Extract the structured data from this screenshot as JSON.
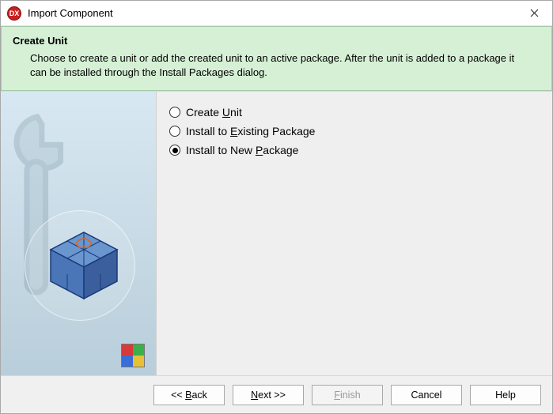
{
  "window": {
    "app_icon_text": "DX",
    "title": "Import Component"
  },
  "header": {
    "title": "Create Unit",
    "description": "Choose to create a unit or add the created unit to an active package. After the unit is added to a package it can be installed through the Install Packages dialog."
  },
  "options": [
    {
      "pre": "Create ",
      "mn": "U",
      "post": "nit",
      "selected": false
    },
    {
      "pre": "Install to ",
      "mn": "E",
      "post": "xisting Package",
      "selected": false
    },
    {
      "pre": "Install to New ",
      "mn": "P",
      "post": "ackage",
      "selected": true
    }
  ],
  "buttons": {
    "back": {
      "pre": "<< ",
      "mn": "B",
      "post": "ack",
      "disabled": false
    },
    "next": {
      "pre": "",
      "mn": "N",
      "post": "ext >>",
      "disabled": false
    },
    "finish": {
      "pre": "",
      "mn": "F",
      "post": "inish",
      "disabled": true
    },
    "cancel": {
      "pre": "Cancel",
      "mn": "",
      "post": "",
      "disabled": false
    },
    "help": {
      "pre": "Help",
      "mn": "",
      "post": "",
      "disabled": false
    }
  }
}
